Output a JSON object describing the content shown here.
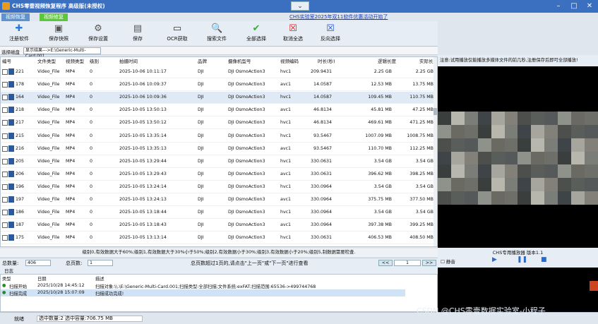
{
  "title": "CHS零壹视频恢复程序 高级版(未授权)",
  "tabs": [
    "视频恢复",
    "视频修复"
  ],
  "promo": "CHS实验室2025年双11软件优惠活动开始了",
  "toolbar": [
    "注册软件",
    "保存快照",
    "保存设置",
    "保存",
    "OCR获取",
    "搜索文件",
    "全部选择",
    "取消全选",
    "反向选择"
  ],
  "path": {
    "label": "选择磁盘",
    "value": "显示结果--->E:\\Generic-Multi-Card.001"
  },
  "columns": [
    "编号",
    "文件类型",
    "视频类型",
    "级别",
    "拍摄时间",
    "品牌",
    "摄像机型号",
    "视频编码",
    "时长(秒)",
    "逻辑长度",
    "实际长度"
  ],
  "rows": [
    [
      "221",
      "Video_File",
      "MP4",
      "0",
      "2025-10-06 10:11:17",
      "DJI",
      "DJI OsmoAction3",
      "hvc1",
      "209.9431",
      "2.25 GB",
      "2.25 GB"
    ],
    [
      "178",
      "Video_File",
      "MP4",
      "0",
      "2025-10-06 10:09:37",
      "DJI",
      "DJI OsmoAction3",
      "avc1",
      "14.0587",
      "12.53 MB",
      "13.75 MB"
    ],
    [
      "164",
      "Video_File",
      "MP4",
      "0",
      "2025-10-06 10:09:36",
      "DJI",
      "DJI OsmoAction3",
      "hvc1",
      "14.0587",
      "109.45 MB",
      "110.75 MB"
    ],
    [
      "218",
      "Video_File",
      "MP4",
      "0",
      "2025-10-05 13:50:13",
      "DJI",
      "DJI OsmoAction3",
      "avc1",
      "46.8134",
      "45.81 MB",
      "47.25 MB"
    ],
    [
      "217",
      "Video_File",
      "MP4",
      "0",
      "2025-10-05 13:50:12",
      "DJI",
      "DJI OsmoAction3",
      "hvc1",
      "46.8134",
      "469.61 MB",
      "471.25 MB"
    ],
    [
      "215",
      "Video_File",
      "MP4",
      "0",
      "2025-10-05 13:35:14",
      "DJI",
      "DJI OsmoAction3",
      "hvc1",
      "93.5467",
      "1007.09 MB",
      "1008.75 MB"
    ],
    [
      "216",
      "Video_File",
      "MP4",
      "0",
      "2025-10-05 13:35:13",
      "DJI",
      "DJI OsmoAction3",
      "avc1",
      "93.5467",
      "110.70 MB",
      "112.25 MB"
    ],
    [
      "205",
      "Video_File",
      "MP4",
      "0",
      "2025-10-05 13:29:44",
      "DJI",
      "DJI OsmoAction3",
      "hvc1",
      "330.0631",
      "3.54 GB",
      "3.54 GB"
    ],
    [
      "206",
      "Video_File",
      "MP4",
      "0",
      "2025-10-05 13:29:43",
      "DJI",
      "DJI OsmoAction3",
      "avc1",
      "330.0631",
      "396.62 MB",
      "398.25 MB"
    ],
    [
      "196",
      "Video_File",
      "MP4",
      "0",
      "2025-10-05 13:24:14",
      "DJI",
      "DJI OsmoAction3",
      "hvc1",
      "330.0964",
      "3.54 GB",
      "3.54 GB"
    ],
    [
      "197",
      "Video_File",
      "MP4",
      "0",
      "2025-10-05 13:24:13",
      "DJI",
      "DJI OsmoAction3",
      "avc1",
      "330.0964",
      "375.75 MB",
      "377.50 MB"
    ],
    [
      "186",
      "Video_File",
      "MP4",
      "0",
      "2025-10-05 13:18:44",
      "DJI",
      "DJI OsmoAction3",
      "hvc1",
      "330.0964",
      "3.54 GB",
      "3.54 GB"
    ],
    [
      "187",
      "Video_File",
      "MP4",
      "0",
      "2025-10-05 13:18:43",
      "DJI",
      "DJI OsmoAction3",
      "avc1",
      "330.0964",
      "397.38 MB",
      "399.25 MB"
    ],
    [
      "175",
      "Video_File",
      "MP4",
      "0",
      "2025-10-05 13:13:14",
      "DJI",
      "DJI OsmoAction3",
      "hvc1",
      "330.0631",
      "406.53 MB",
      "408.50 MB"
    ]
  ],
  "legend": "级别0,有效数据大于60%;级别1,有效数据大于30%小于50%;级别2,有效数据小于30%;级别3,有效数据小于20%;级别5,制数据需要检查.",
  "status": {
    "total_label": "总数量:",
    "total": "406",
    "pages_label": "总页数:",
    "pages": "1",
    "hint": "总页数超过1页的,请点击\"上一页\"或\"下一页\"进行查看",
    "prev": "<<",
    "page": "1",
    "next": ">>"
  },
  "log": {
    "title": "日志",
    "cols": [
      "类型",
      "日期",
      "描述"
    ],
    "rows": [
      [
        "扫描开始",
        "2025/10/28 14:45:12",
        "扫描对象:\\\\.\\E:\\Generic-Multi-Card.001;扫描类型:全部扫描;文件系统:exFAT;扫描范围:65536->499744768"
      ],
      [
        "扫描完成",
        "2025/10/28 15:07:09",
        "扫描成功完成!"
      ]
    ]
  },
  "bottom": {
    "ready": "就绪",
    "summary": "选中数量:2 选中容量:706.75 MB"
  },
  "note": "注意:试用播放仅能播放多媒体文件的前几秒,注册保存后即可全部播放!",
  "player": {
    "title": "CHS专用播放器 版本1.1",
    "mute": "静音"
  },
  "watermark": "CSDN @CHS零壹数据实验室-小程子"
}
